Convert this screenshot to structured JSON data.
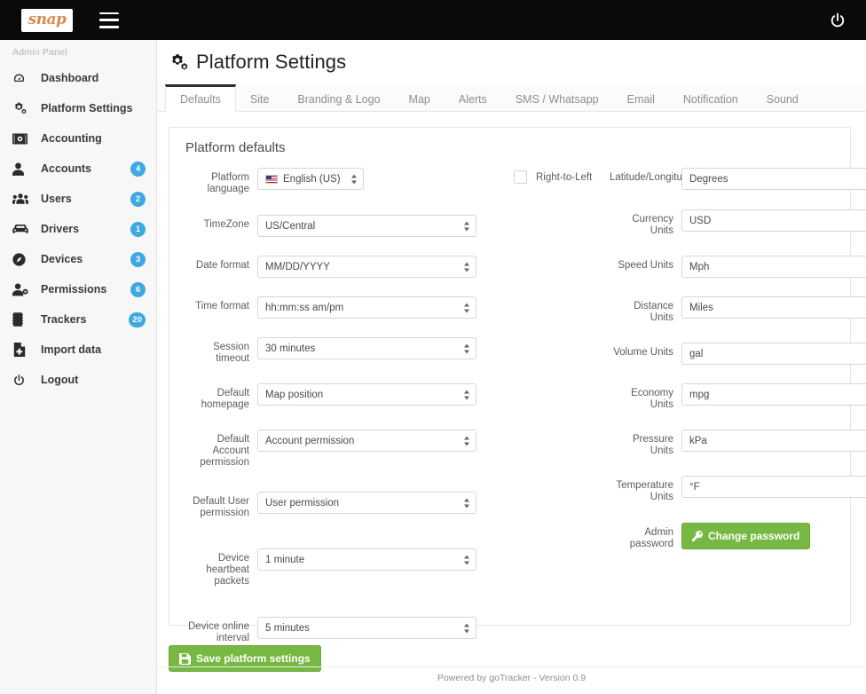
{
  "topbar": {
    "logo_text": "snap",
    "menu_icon": "hamburger-icon",
    "power_icon": "power-icon"
  },
  "sidebar": {
    "header": "Admin Panel",
    "items": [
      {
        "label": "Dashboard",
        "icon": "dashboard-icon",
        "badge": ""
      },
      {
        "label": "Platform Settings",
        "icon": "gears-icon",
        "badge": ""
      },
      {
        "label": "Accounting",
        "icon": "money-icon",
        "badge": ""
      },
      {
        "label": "Accounts",
        "icon": "user-icon",
        "badge": "4"
      },
      {
        "label": "Users",
        "icon": "users-icon",
        "badge": "2"
      },
      {
        "label": "Drivers",
        "icon": "car-icon",
        "badge": "1"
      },
      {
        "label": "Devices",
        "icon": "compass-icon",
        "badge": "3"
      },
      {
        "label": "Permissions",
        "icon": "user-gear-icon",
        "badge": "6"
      },
      {
        "label": "Trackers",
        "icon": "tracker-icon",
        "badge": "20"
      },
      {
        "label": "Import data",
        "icon": "import-icon",
        "badge": ""
      },
      {
        "label": "Logout",
        "icon": "power-icon",
        "badge": ""
      }
    ],
    "badge_color": "#3fa8e0"
  },
  "page": {
    "title": "Platform Settings",
    "title_icon": "gears-icon"
  },
  "tabs": [
    {
      "label": "Defaults",
      "active": true
    },
    {
      "label": "Site",
      "active": false
    },
    {
      "label": "Branding & Logo",
      "active": false
    },
    {
      "label": "Map",
      "active": false
    },
    {
      "label": "Alerts",
      "active": false
    },
    {
      "label": "SMS / Whatsapp",
      "active": false
    },
    {
      "label": "Email",
      "active": false
    },
    {
      "label": "Notification",
      "active": false
    },
    {
      "label": "Sound",
      "active": false
    }
  ],
  "panel": {
    "title": "Platform defaults",
    "left_fields": [
      {
        "label": "Platform language",
        "value": "English (US)",
        "flag": true
      },
      {
        "label": "TimeZone",
        "value": "US/Central",
        "flag": false
      },
      {
        "label": "Date format",
        "value": "MM/DD/YYYY",
        "flag": false
      },
      {
        "label": "Time format",
        "value": "hh:mm:ss am/pm",
        "flag": false
      },
      {
        "label": "Session timeout",
        "value": "30 minutes",
        "flag": false
      },
      {
        "label": "Default homepage",
        "value": "Map position",
        "flag": false
      },
      {
        "label": "Default Account permission",
        "value": "Account permission",
        "flag": false
      },
      {
        "label": "Default User permission",
        "value": "User permission",
        "flag": false
      },
      {
        "label": "Device heartbeat packets",
        "value": "1 minute",
        "flag": false
      },
      {
        "label": "Device online interval",
        "value": "5 minutes",
        "flag": false
      }
    ],
    "rtl": {
      "label": "Right-to-Left",
      "checked": false
    },
    "right_fields": [
      {
        "label": "Latitude/Longitude Format",
        "value": "Degrees"
      },
      {
        "label": "Currency Units",
        "value": "USD"
      },
      {
        "label": "Speed Units",
        "value": "Mph"
      },
      {
        "label": "Distance Units",
        "value": "Miles"
      },
      {
        "label": "Volume Units",
        "value": "gal"
      },
      {
        "label": "Economy Units",
        "value": "mpg"
      },
      {
        "label": "Pressure Units",
        "value": "kPa"
      },
      {
        "label": "Temperature Units",
        "value": "°F"
      }
    ],
    "admin_password": {
      "label": "Admin password",
      "button_label": "Change password",
      "button_icon": "key-icon"
    }
  },
  "actions": {
    "save_label": "Save platform settings",
    "save_icon": "floppy-icon",
    "save_color": "#77b843"
  },
  "footer": {
    "text": "Powered by goTracker - Version 0.9"
  }
}
